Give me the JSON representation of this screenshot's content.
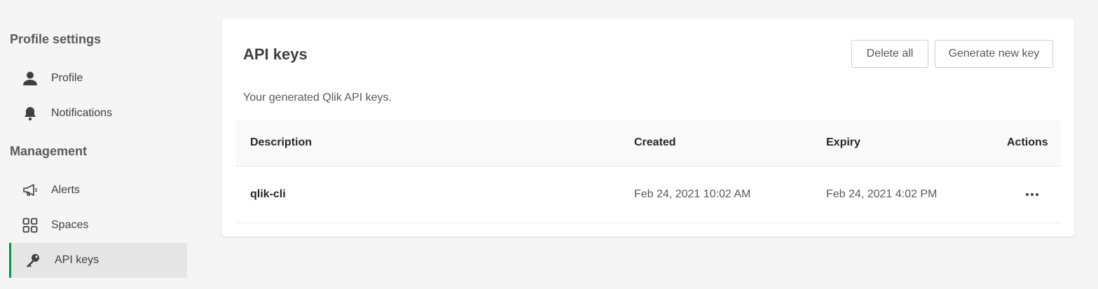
{
  "sidebar": {
    "profile_section": "Profile settings",
    "management_section": "Management",
    "items": [
      {
        "label": "Profile",
        "icon": "person-icon"
      },
      {
        "label": "Notifications",
        "icon": "bell-icon"
      },
      {
        "label": "Alerts",
        "icon": "megaphone-icon"
      },
      {
        "label": "Spaces",
        "icon": "spaces-grid-icon"
      },
      {
        "label": "API keys",
        "icon": "key-icon",
        "active": true
      }
    ]
  },
  "main": {
    "title": "API keys",
    "subtitle": "Your generated Qlik API keys.",
    "buttons": {
      "delete_all": "Delete all",
      "generate": "Generate new key"
    },
    "table": {
      "headers": [
        "Description",
        "Created",
        "Expiry",
        "Actions"
      ],
      "rows": [
        {
          "description": "qlik-cli",
          "created": "Feb 24, 2021 10:02 AM",
          "expiry": "Feb 24, 2021 4:02 PM"
        }
      ]
    }
  },
  "colors": {
    "accent": "#009845",
    "background": "#f5f5f5",
    "active_item": "#e6e6e6"
  }
}
